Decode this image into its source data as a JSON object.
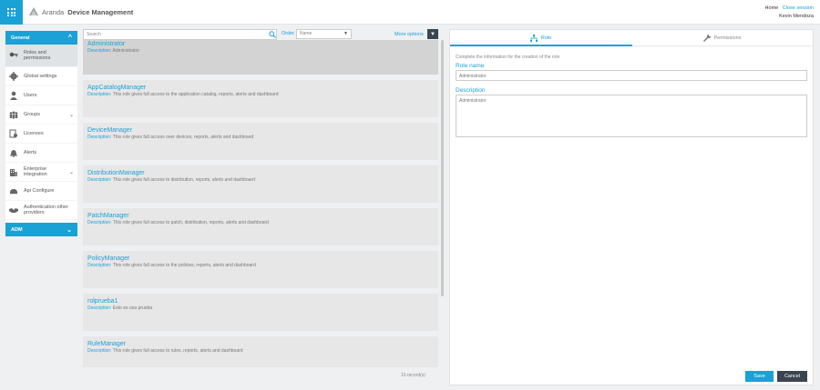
{
  "header": {
    "logo_light": "Aranda",
    "logo_bold": "Device Management",
    "home_link": "Home",
    "close_session_link": "Close session",
    "user_name": "Kevin Mendoza"
  },
  "sidebar": {
    "general_label": "General",
    "items": [
      {
        "label": "Roles and permissions",
        "icon": "key-icon"
      },
      {
        "label": "Global settings",
        "icon": "gear-icon"
      },
      {
        "label": "Users",
        "icon": "user-icon"
      },
      {
        "label": "Groups",
        "icon": "groups-icon"
      },
      {
        "label": "Licenses",
        "icon": "license-icon"
      },
      {
        "label": "Alerts",
        "icon": "bell-icon"
      },
      {
        "label": "Enterprise integration",
        "icon": "building-icon"
      },
      {
        "label": "Api Configure",
        "icon": "api-icon"
      },
      {
        "label": "Authentication other providers",
        "icon": "handshake-icon"
      }
    ],
    "adm_label": "ADM"
  },
  "toolbar": {
    "search_placeholder": "Search",
    "order_label": "Order",
    "order_value": "Name",
    "more_options": "More options"
  },
  "roles": [
    {
      "name": "Administrator",
      "desc_label": "Description:",
      "desc": "Administrator"
    },
    {
      "name": "AppCatalogManager",
      "desc_label": "Description:",
      "desc": "This role gives full access to the application catalog, reports, alerts and dashboard"
    },
    {
      "name": "DeviceManager",
      "desc_label": "Description:",
      "desc": "This role gives full access over devices, reports, alerts and dashboard"
    },
    {
      "name": "DistributionManager",
      "desc_label": "Description:",
      "desc": "This role gives full access to distribution, reports, alerts and dashboard"
    },
    {
      "name": "PatchManager",
      "desc_label": "Description:",
      "desc": "This role gives full access to patch, distribution, reports, alerts and dashboard"
    },
    {
      "name": "PolicyManager",
      "desc_label": "Description:",
      "desc": "This role gives full access to the policies, reports, alerts and dashboard"
    },
    {
      "name": "rolprueba1",
      "desc_label": "Description:",
      "desc": "Esto es una prueba"
    },
    {
      "name": "RuleManager",
      "desc_label": "Description:",
      "desc": "This role gives full access to rules, reports, alerts and dashboard"
    }
  ],
  "records": "10 record(s)",
  "form": {
    "tab_role": "Role",
    "tab_permissions": "Permissions",
    "intro": "Complete the information for the creation of the role",
    "role_name_label": "Role name",
    "role_name_value": "Administrator",
    "description_label": "Description",
    "description_value": "Administrator",
    "save": "Save",
    "cancel": "Cancel"
  },
  "colors": {
    "accent": "#1aa1d6",
    "dark": "#3a4550"
  }
}
